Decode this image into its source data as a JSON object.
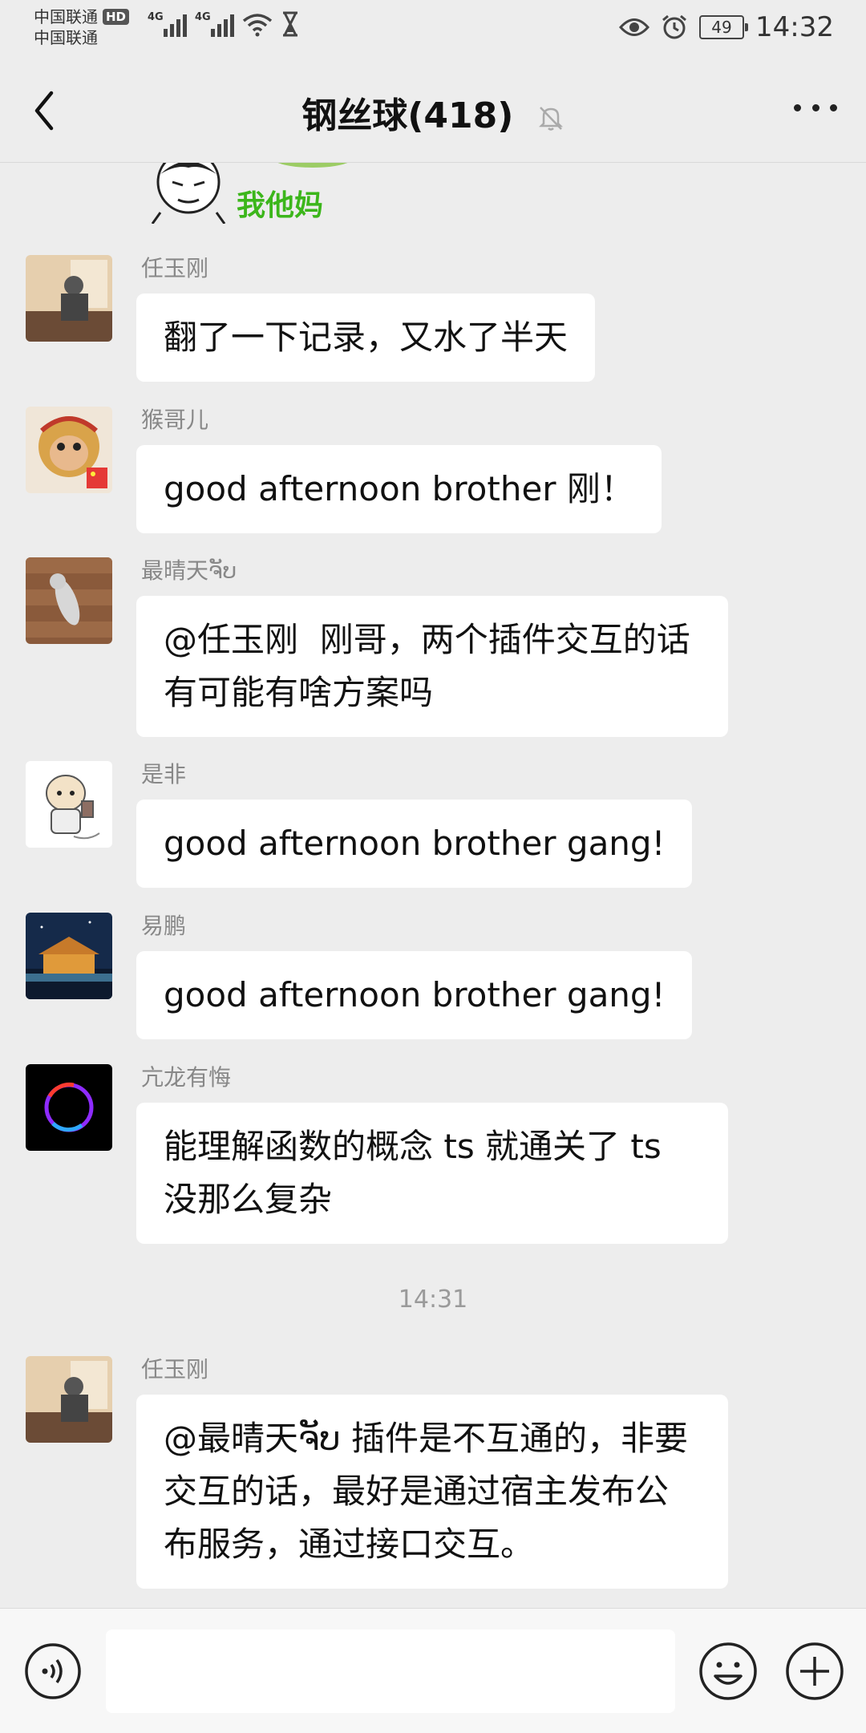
{
  "status_bar": {
    "carrier1": "中国联通",
    "carrier2": "中国联通",
    "hd_badge": "HD",
    "network1": "4G",
    "network2": "4G",
    "battery": "49",
    "time": "14:32"
  },
  "header": {
    "title": "钢丝球(418)"
  },
  "sticker": {
    "text": "我他妈"
  },
  "messages": [
    {
      "sender": "任玉刚",
      "text": "翻了一下记录，又水了半天"
    },
    {
      "sender": "猴哥儿",
      "text": "good afternoon brother 刚！"
    },
    {
      "sender": "最晴天ຈັບ",
      "text": "@任玉刚  刚哥，两个插件交互的话有可能有啥方案吗"
    },
    {
      "sender": "是非",
      "text": "good afternoon brother gang!"
    },
    {
      "sender": "易鹏",
      "text": "good afternoon brother gang!"
    },
    {
      "sender": "亢龙有悔",
      "text": "能理解函数的概念 ts 就通关了 ts 没那么复杂"
    },
    {
      "sender": "任玉刚",
      "text": "@最晴天ຈັບ 插件是不互通的，非要交互的话，最好是通过宿主发布公布服务，通过接口交互。"
    }
  ],
  "timestamp": "14:31",
  "colors": {
    "background": "#ededed",
    "bubble": "#ffffff",
    "sticker_text": "#3cb61b"
  }
}
